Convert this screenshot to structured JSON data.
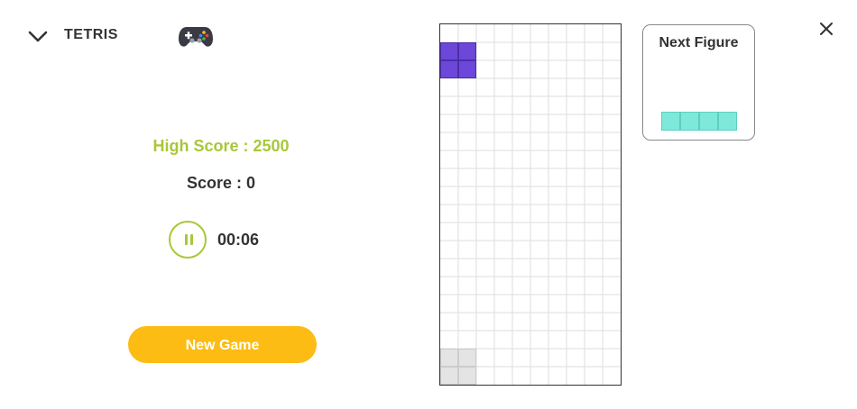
{
  "header": {
    "title": "TETRIS",
    "collapse_icon": "chevron-down-icon",
    "game_icon": "gamepad-icon",
    "close_icon": "close-icon"
  },
  "stats": {
    "high_score_text": "High Score  : 2500",
    "score_text": "Score : 0",
    "timer": "00:06",
    "pause_icon": "pause-icon"
  },
  "actions": {
    "new_game_label": "New Game"
  },
  "next_figure": {
    "label": "Next Figure",
    "piece": "I",
    "cells": [
      [
        0,
        0
      ],
      [
        1,
        0
      ],
      [
        2,
        0
      ],
      [
        3,
        0
      ]
    ],
    "color": "#7ee8da"
  },
  "board": {
    "cols": 10,
    "rows": 20,
    "grid_color": "#dddddd",
    "active_piece": {
      "type": "O",
      "color": "#6c47d9",
      "cells": [
        [
          0,
          1
        ],
        [
          1,
          1
        ],
        [
          0,
          2
        ],
        [
          1,
          2
        ]
      ]
    },
    "ghost_piece": {
      "color": "#e4e4e4",
      "cells": [
        [
          0,
          18
        ],
        [
          1,
          18
        ],
        [
          0,
          19
        ],
        [
          1,
          19
        ]
      ]
    }
  },
  "colors": {
    "accent_green": "#a8c73a",
    "button_yellow": "#fcbc14",
    "text_dark": "#333333"
  }
}
